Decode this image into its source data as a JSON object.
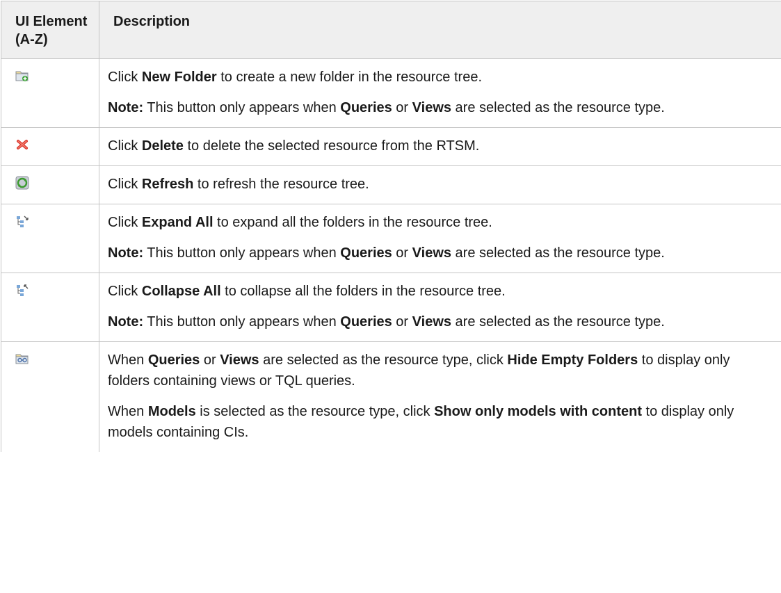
{
  "table": {
    "header": {
      "ui_element_line1": "UI Element",
      "ui_element_line2": "(A-Z)",
      "description": "Description"
    },
    "rows": [
      {
        "icon": "new-folder-icon",
        "paragraphs": [
          [
            {
              "t": "Click "
            },
            {
              "b": "New Folder"
            },
            {
              "t": " to create a new folder in the resource tree."
            }
          ],
          [
            {
              "b": "Note:"
            },
            {
              "t": " This button only appears when "
            },
            {
              "b": "Queries"
            },
            {
              "t": " or "
            },
            {
              "b": "Views"
            },
            {
              "t": " are selected as the resource type."
            }
          ]
        ]
      },
      {
        "icon": "delete-icon",
        "paragraphs": [
          [
            {
              "t": "Click "
            },
            {
              "b": "Delete"
            },
            {
              "t": " to delete the selected resource from the RTSM."
            }
          ]
        ]
      },
      {
        "icon": "refresh-icon",
        "paragraphs": [
          [
            {
              "t": "Click "
            },
            {
              "b": "Refresh"
            },
            {
              "t": " to refresh the resource tree."
            }
          ]
        ]
      },
      {
        "icon": "expand-all-icon",
        "paragraphs": [
          [
            {
              "t": "Click "
            },
            {
              "b": "Expand All"
            },
            {
              "t": " to expand all the folders in the resource tree."
            }
          ],
          [
            {
              "b": "Note:"
            },
            {
              "t": " This button only appears when "
            },
            {
              "b": "Queries"
            },
            {
              "t": " or "
            },
            {
              "b": "Views"
            },
            {
              "t": " are selected as the resource type."
            }
          ]
        ]
      },
      {
        "icon": "collapse-all-icon",
        "paragraphs": [
          [
            {
              "t": "Click "
            },
            {
              "b": "Collapse All"
            },
            {
              "t": " to collapse all the folders in the resource tree."
            }
          ],
          [
            {
              "b": "Note:"
            },
            {
              "t": " This button only appears when "
            },
            {
              "b": "Queries"
            },
            {
              "t": " or "
            },
            {
              "b": "Views"
            },
            {
              "t": " are selected as the resource type."
            }
          ]
        ]
      },
      {
        "icon": "hide-empty-folders-icon",
        "paragraphs": [
          [
            {
              "t": "When "
            },
            {
              "b": "Queries"
            },
            {
              "t": " or "
            },
            {
              "b": "Views"
            },
            {
              "t": " are selected as the resource type, click "
            },
            {
              "b": "Hide Empty Folders"
            },
            {
              "t": " to display only folders containing views or TQL queries."
            }
          ],
          [
            {
              "t": "When "
            },
            {
              "b": "Models"
            },
            {
              "t": " is selected as the resource type, click "
            },
            {
              "b": "Show only models with content"
            },
            {
              "t": " to display only models containing CIs."
            }
          ]
        ]
      }
    ]
  }
}
